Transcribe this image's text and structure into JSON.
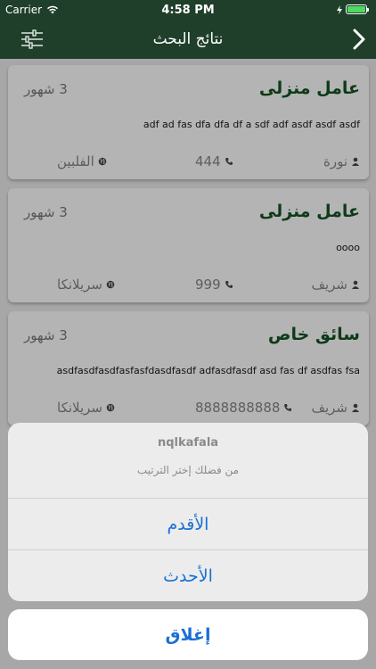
{
  "status_bar": {
    "carrier": "Carrier",
    "time": "4:58 PM"
  },
  "nav": {
    "title": "نتائج البحث"
  },
  "cards": [
    {
      "title": "عامل منزلى",
      "age": "3 شهور",
      "description": "adf ad fas dfa dfa df a sdf adf asdf asdf asdf",
      "owner": "نورة",
      "phone": "444",
      "country": "الفلبين"
    },
    {
      "title": "عامل منزلى",
      "age": "3 شهور",
      "description": "oooo",
      "owner": "شريف",
      "phone": "999",
      "country": "سريلانكا"
    },
    {
      "title": "سائق خاص",
      "age": "3 شهور",
      "description": "asdfasdfasdfasfasfdasdfasdf adfasdfasdf asd fas df asdfas fsa",
      "owner": "شريف",
      "phone": "8888888888",
      "country": "سريلانكا"
    }
  ],
  "action_sheet": {
    "app_name": "nqlkafala",
    "message": "من فضلك إختر الترتيب",
    "options": [
      "الأقدم",
      "الأحدث"
    ],
    "cancel": "إغلاق"
  },
  "colors": {
    "nav_bg": "#1f3f2b",
    "title_green": "#0e3a18",
    "action_blue": "#1a6fd6"
  }
}
